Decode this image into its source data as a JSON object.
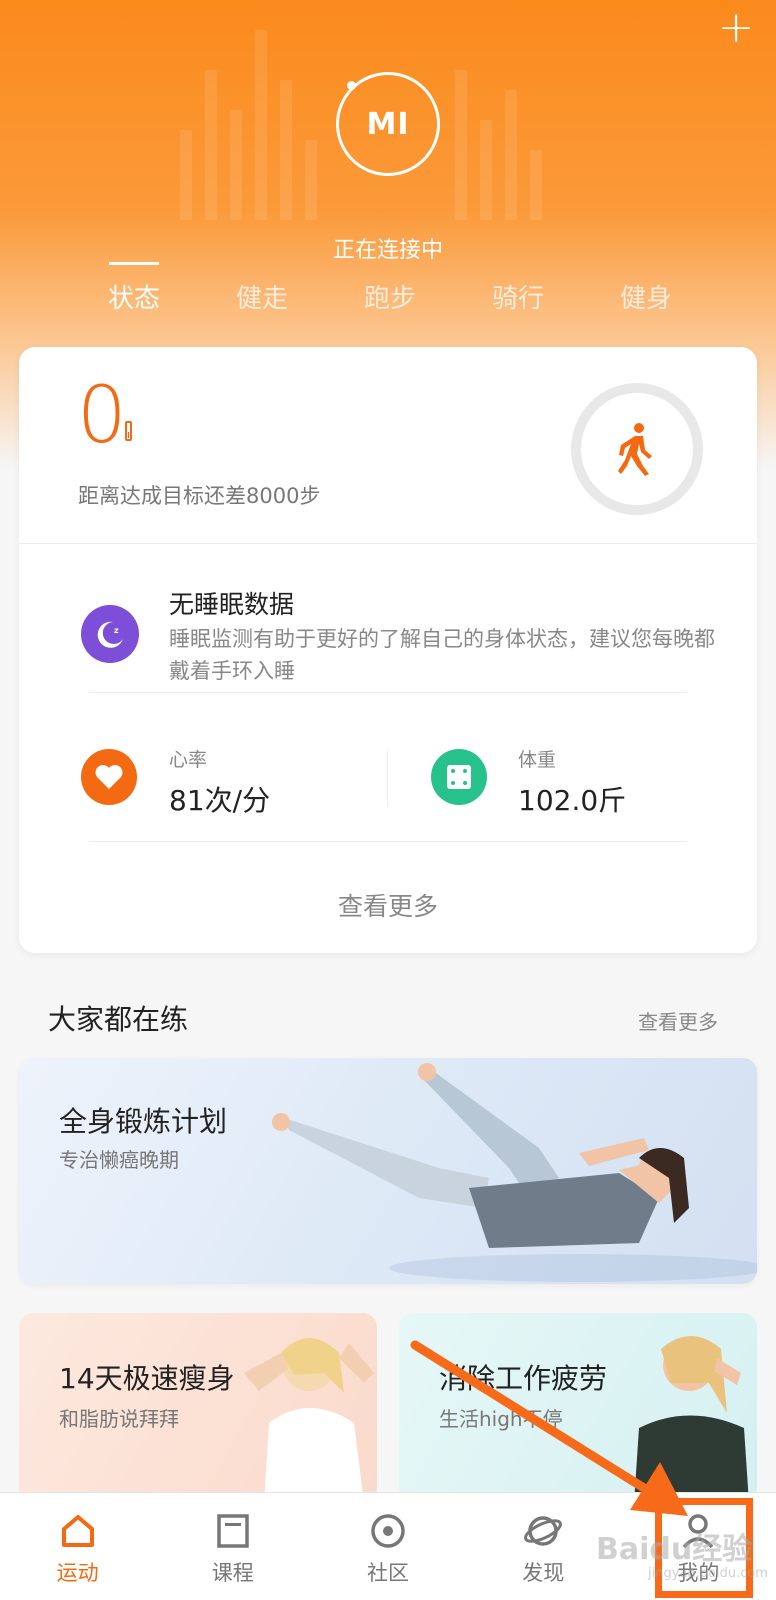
{
  "header": {
    "add_icon": "plus-icon",
    "device_logo": "MI",
    "connection_status": "正在连接中",
    "tabs": [
      {
        "label": "状态",
        "active": true
      },
      {
        "label": "健走",
        "active": false
      },
      {
        "label": "跑步",
        "active": false
      },
      {
        "label": "骑行",
        "active": false
      },
      {
        "label": "健身",
        "active": false
      }
    ]
  },
  "summary": {
    "steps": "0",
    "goal_text": "距离达成目标还差8000步",
    "step_icon": "walking-icon",
    "sleep": {
      "icon": "moon-icon",
      "title": "无睡眠数据",
      "description": "睡眠监测有助于更好的了解自己的身体状态，建议您每晚都戴着手环入睡"
    },
    "heart_rate": {
      "icon": "heart-icon",
      "label": "心率",
      "value": "81次/分"
    },
    "weight": {
      "icon": "scale-icon",
      "label": "体重",
      "value": "102.0斤"
    },
    "more_label": "查看更多"
  },
  "training": {
    "section_title": "大家都在练",
    "more_label": "查看更多",
    "featured": {
      "title": "全身锻炼计划",
      "subtitle": "专治懒癌晚期"
    },
    "cards": [
      {
        "title": "14天极速瘦身",
        "subtitle": "和脂肪说拜拜"
      },
      {
        "title": "消除工作疲劳",
        "subtitle": "生活high不停"
      }
    ]
  },
  "bottom_nav": [
    {
      "label": "运动",
      "icon": "home-icon",
      "active": true
    },
    {
      "label": "课程",
      "icon": "course-icon",
      "active": false
    },
    {
      "label": "社区",
      "icon": "community-icon",
      "active": false
    },
    {
      "label": "发现",
      "icon": "discover-icon",
      "active": false
    },
    {
      "label": "我的",
      "icon": "profile-icon",
      "active": false
    }
  ],
  "overlay": {
    "watermark": "Baidu经验",
    "watermark_url": "jingyan.baidu.com"
  },
  "colors": {
    "accent": "#f46a12",
    "sleep": "#7d4ed8",
    "weight": "#27c28b",
    "highlight": "#f76a1a"
  }
}
